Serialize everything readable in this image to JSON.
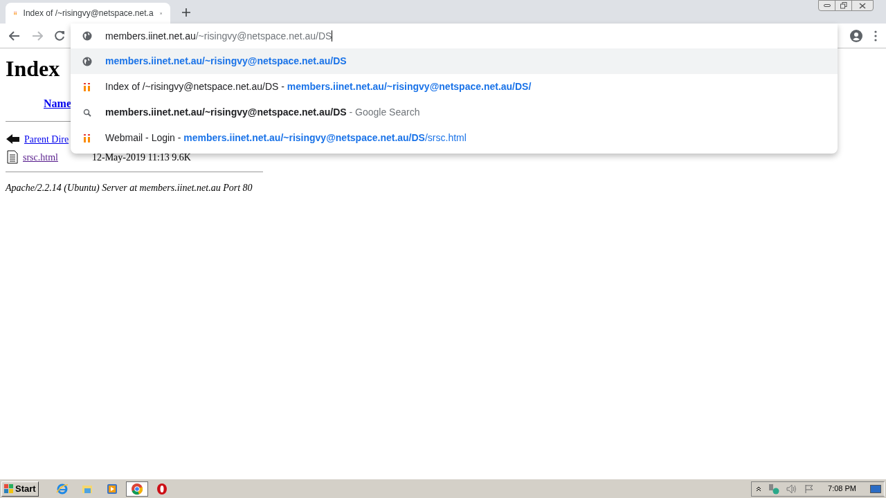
{
  "tab": {
    "title": "Index of /~risingvy@netspace.net.a",
    "selected": true
  },
  "omnibox": {
    "segments": [
      {
        "kind": "plain",
        "text": "members.iinet.net.au"
      },
      {
        "kind": "dim",
        "text": "/~risingvy@netspace.net.au/DS"
      }
    ]
  },
  "suggestions": [
    {
      "kind": "globe",
      "selected": true,
      "segments": [
        {
          "kind": "link_match",
          "text": "members.iinet.net.au/~risingvy@netspace.net.au/DS"
        }
      ]
    },
    {
      "kind": "favicon",
      "selected": false,
      "segments": [
        {
          "kind": "plain",
          "text": "Index of /~risingvy@netspace.net.au/DS - "
        },
        {
          "kind": "link_match",
          "text": "members.iinet.net.au/~risingvy@netspace.net.au/DS/"
        }
      ]
    },
    {
      "kind": "search",
      "selected": false,
      "segments": [
        {
          "kind": "match",
          "text": "members.iinet.net.au/~risingvy@netspace.net.au/DS"
        },
        {
          "kind": "dim",
          "text": " - Google Search"
        }
      ]
    },
    {
      "kind": "favicon",
      "selected": false,
      "segments": [
        {
          "kind": "plain",
          "text": "Webmail - Login - "
        },
        {
          "kind": "link_match",
          "text": "members.iinet.net.au/~risingvy@netspace.net.au/DS"
        },
        {
          "kind": "link",
          "text": "/srsc.html"
        }
      ]
    }
  ],
  "page": {
    "heading": "Index",
    "column_header": "Name",
    "rows": [
      {
        "kind": "parent",
        "name": "Parent Dire"
      },
      {
        "kind": "file",
        "name": "srsc.html",
        "info": "12-May-2019 11:13 9.6K"
      }
    ],
    "address": "Apache/2.2.14 (Ubuntu) Server at members.iinet.net.au Port 80"
  },
  "taskbar": {
    "start": "Start",
    "apps": [
      {
        "kind": "ie",
        "selected": false
      },
      {
        "kind": "folder",
        "selected": false
      },
      {
        "kind": "media",
        "selected": false
      },
      {
        "kind": "chrome",
        "selected": true
      },
      {
        "kind": "opera",
        "selected": false
      }
    ],
    "clock": "7:08 PM"
  }
}
